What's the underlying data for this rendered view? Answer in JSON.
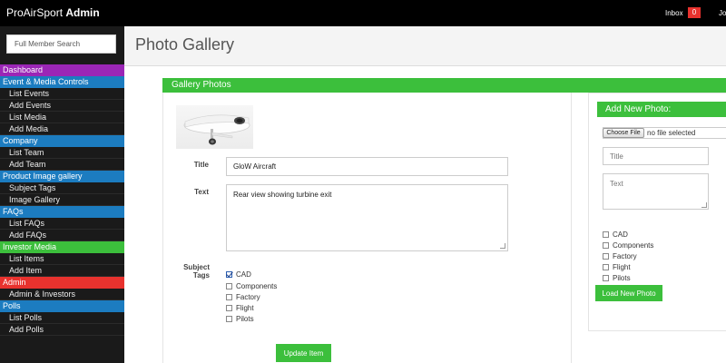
{
  "header": {
    "brand_plain": "ProAirSport",
    "brand_bold": "Admin",
    "inbox_label": "Inbox",
    "inbox_count": "0",
    "jobs_label": "Jo"
  },
  "sidebar": {
    "search_placeholder": "Full Member Search",
    "sections": [
      {
        "title": "Dashboard",
        "color": "#9b26b6",
        "items": []
      },
      {
        "title": "Event & Media Controls",
        "color": "#1c7cc0",
        "items": [
          "List Events",
          "Add Events",
          "List Media",
          "Add Media"
        ]
      },
      {
        "title": "Company",
        "color": "#1c7cc0",
        "items": [
          "List Team",
          "Add Team"
        ]
      },
      {
        "title": "Product Image gallery",
        "color": "#1c7cc0",
        "items": [
          "Subject Tags",
          "Image Gallery"
        ]
      },
      {
        "title": "FAQs",
        "color": "#1c7cc0",
        "items": [
          "List FAQs",
          "Add FAQs"
        ]
      },
      {
        "title": "Investor Media",
        "color": "#3cbf3c",
        "items": [
          "List Items",
          "Add Item"
        ]
      },
      {
        "title": "Admin",
        "color": "#e8322e",
        "items": [
          "Admin & Investors"
        ]
      },
      {
        "title": "Polls",
        "color": "#1c7cc0",
        "items": [
          "List Polls",
          "Add Polls"
        ]
      }
    ]
  },
  "page": {
    "title": "Photo Gallery"
  },
  "gallery": {
    "header": "Gallery Photos",
    "title_label": "Title",
    "title_value": "GloW Aircraft",
    "text_label": "Text",
    "text_value": "Rear view showing turbine exit",
    "tags_label_line1": "Subject",
    "tags_label_line2": "Tags",
    "tags": [
      {
        "label": "CAD",
        "checked": true
      },
      {
        "label": "Components",
        "checked": false
      },
      {
        "label": "Factory",
        "checked": false
      },
      {
        "label": "Flight",
        "checked": false
      },
      {
        "label": "Pilots",
        "checked": false
      }
    ],
    "update_button": "Update Item"
  },
  "add_photo": {
    "header": "Add New Photo:",
    "choose_file_label": "Choose File",
    "file_status": "no file selected",
    "title_placeholder": "Title",
    "text_placeholder": "Text",
    "tags": [
      {
        "label": "CAD",
        "checked": false
      },
      {
        "label": "Components",
        "checked": false
      },
      {
        "label": "Factory",
        "checked": false
      },
      {
        "label": "Flight",
        "checked": false
      },
      {
        "label": "Pilots",
        "checked": false
      }
    ],
    "load_button": "Load New Photo"
  }
}
